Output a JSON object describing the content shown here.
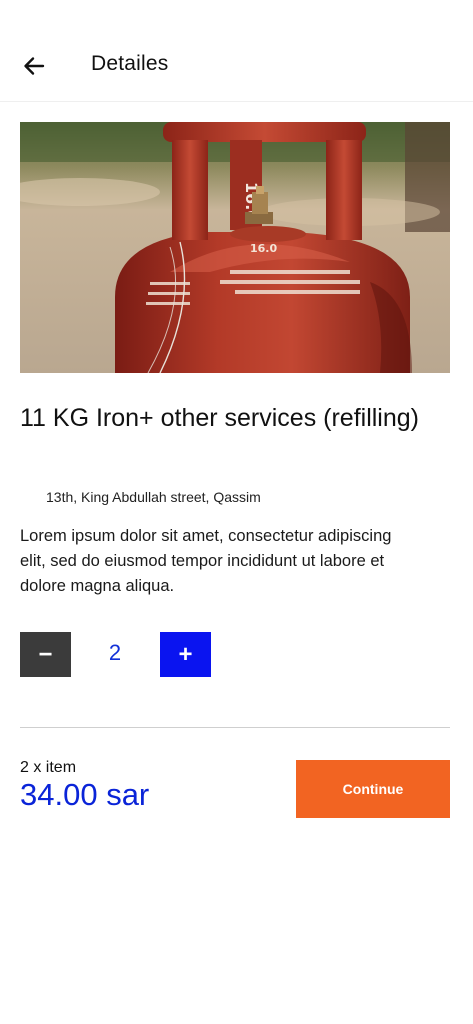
{
  "header": {
    "title": "Detailes",
    "back_icon": "arrow-left-icon"
  },
  "product": {
    "image_icon": "gas-cylinder-photo",
    "title": "11 KG Iron+ other services (refilling)",
    "address": "13th, King Abdullah street, Qassim",
    "description": "Lorem ipsum dolor sit amet, consectetur adipiscing elit, sed do eiusmod tempor incididunt ut labore et dolore magna aliqua."
  },
  "quantity": {
    "minus_label": "−",
    "value": "2",
    "plus_label": "+"
  },
  "summary": {
    "item_count": "2 x item",
    "total": "34.00 sar",
    "continue_label": "Continue"
  },
  "colors": {
    "accent_blue": "#0a14f0",
    "price_blue": "#0a24d8",
    "continue_orange": "#f26422",
    "minus_gray": "#3b3b3b"
  }
}
